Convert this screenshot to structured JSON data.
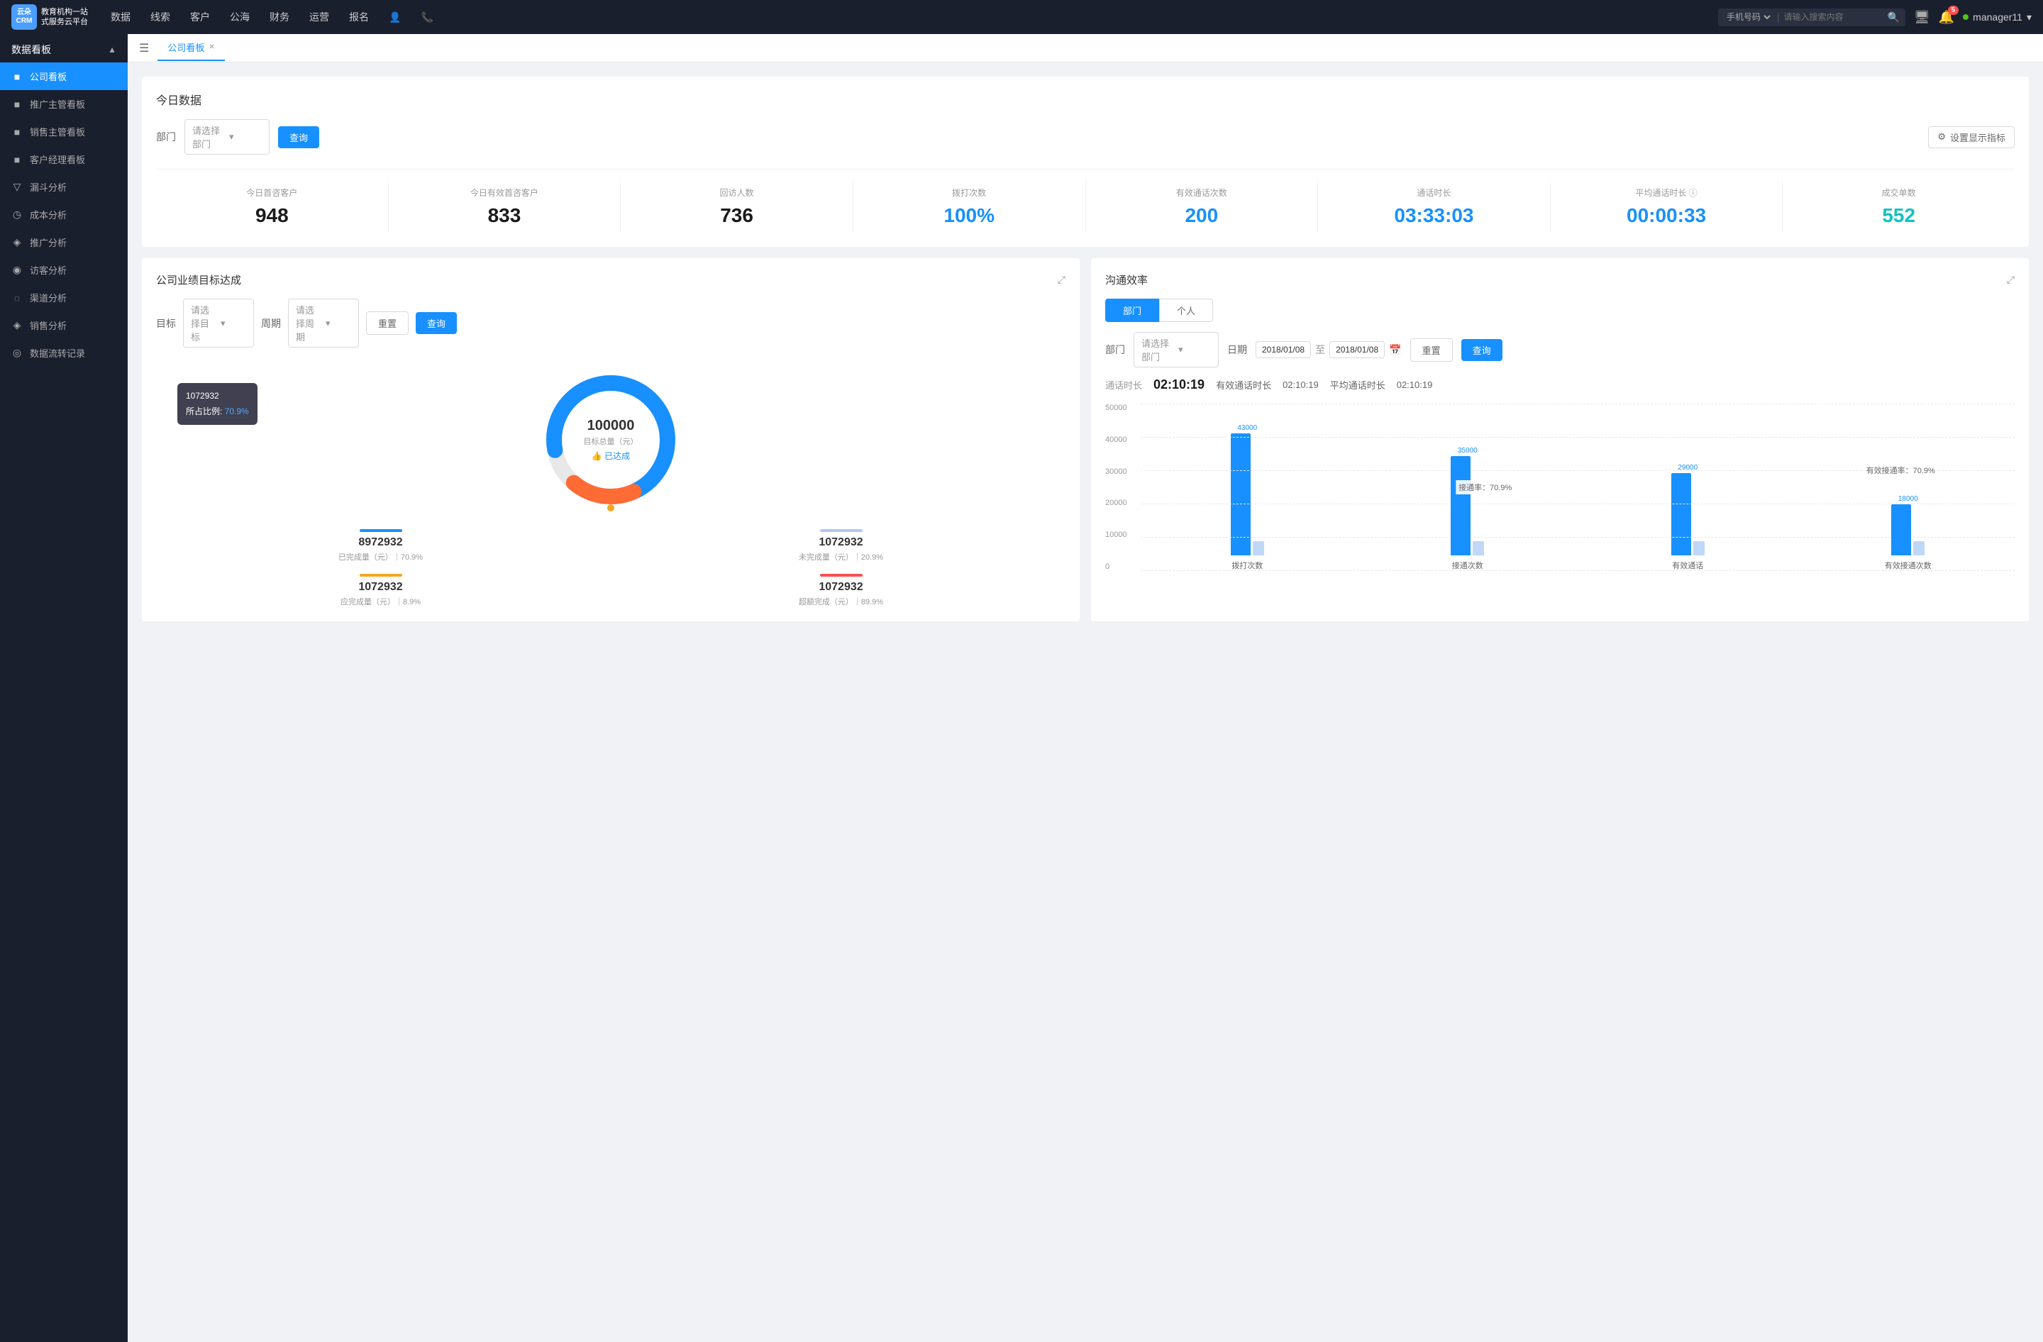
{
  "app": {
    "logo_line1": "云朵CRM",
    "logo_line2": "教育机构一站",
    "logo_line3": "式服务云平台"
  },
  "topnav": {
    "items": [
      "数据",
      "线索",
      "客户",
      "公海",
      "财务",
      "运营",
      "报名"
    ],
    "search_placeholder": "请输入搜索内容",
    "search_select": "手机号码",
    "username": "manager11",
    "notification_count": "5"
  },
  "sidebar": {
    "group_label": "数据看板",
    "items": [
      {
        "label": "公司看板",
        "active": true,
        "icon": "■"
      },
      {
        "label": "推广主管看板",
        "active": false,
        "icon": "■"
      },
      {
        "label": "销售主管看板",
        "active": false,
        "icon": "■"
      },
      {
        "label": "客户经理看板",
        "active": false,
        "icon": "■"
      },
      {
        "label": "漏斗分析",
        "active": false,
        "icon": "▽"
      },
      {
        "label": "成本分析",
        "active": false,
        "icon": "◷"
      },
      {
        "label": "推广分析",
        "active": false,
        "icon": "◈"
      },
      {
        "label": "访客分析",
        "active": false,
        "icon": "◉"
      },
      {
        "label": "渠道分析",
        "active": false,
        "icon": "◌"
      },
      {
        "label": "销售分析",
        "active": false,
        "icon": "◈"
      },
      {
        "label": "数据流转记录",
        "active": false,
        "icon": "◎"
      }
    ]
  },
  "tab": {
    "label": "公司看板"
  },
  "today_section": {
    "title": "今日数据",
    "filter_label": "部门",
    "select_placeholder": "请选择部门",
    "query_btn": "查询",
    "settings_btn": "设置显示指标",
    "stats": [
      {
        "label": "今日首咨客户",
        "value": "948",
        "color": "normal"
      },
      {
        "label": "今日有效首咨客户",
        "value": "833",
        "color": "normal"
      },
      {
        "label": "回访人数",
        "value": "736",
        "color": "normal"
      },
      {
        "label": "拨打次数",
        "value": "100%",
        "color": "blue"
      },
      {
        "label": "有效通话次数",
        "value": "200",
        "color": "blue"
      },
      {
        "label": "通话时长",
        "value": "03:33:03",
        "color": "blue"
      },
      {
        "label": "平均通话时长",
        "value": "00:00:33",
        "color": "blue"
      },
      {
        "label": "成交单数",
        "value": "552",
        "color": "cyan"
      }
    ]
  },
  "goal_section": {
    "title": "公司业绩目标达成",
    "goal_label": "目标",
    "goal_placeholder": "请选择目标",
    "period_label": "周期",
    "period_placeholder": "请选择周期",
    "reset_btn": "重置",
    "query_btn": "查询",
    "donut": {
      "total": "100000",
      "total_label": "目标总量（元）",
      "badge": "👍 已达成",
      "tooltip_id": "1072932",
      "tooltip_pct": "70.9%",
      "completed_value": "8972932",
      "completed_label": "已完成量（元）",
      "completed_pct": "70.9%",
      "uncompleted_value": "1072932",
      "uncompleted_label": "未完成量（元）",
      "uncompleted_pct": "20.9%",
      "should_complete_value": "1072932",
      "should_complete_label": "应完成量（元）",
      "should_complete_pct": "8.9%",
      "over_complete_value": "1072932",
      "over_complete_label": "超额完成（元）",
      "over_complete_pct": "89.9%"
    }
  },
  "comm_section": {
    "title": "沟通效率",
    "tab_dept": "部门",
    "tab_person": "个人",
    "dept_label": "部门",
    "dept_placeholder": "请选择部门",
    "date_label": "日期",
    "date_from": "2018/01/08",
    "date_to": "2018/01/08",
    "reset_btn": "重置",
    "query_btn": "查询",
    "call_duration_label": "通话时长",
    "call_duration_value": "02:10:19",
    "effective_label": "有效通话时长",
    "effective_value": "02:10:19",
    "avg_label": "平均通话时长",
    "avg_value": "02:10:19",
    "chart": {
      "y_ticks": [
        "50000",
        "40000",
        "30000",
        "20000",
        "10000",
        "0"
      ],
      "groups": [
        {
          "label": "拨打次数",
          "bars": [
            {
              "value": 43000,
              "label": "43000",
              "color": "#1890ff",
              "height": 172
            },
            {
              "value": 0,
              "label": "",
              "color": "#b0c8f0",
              "height": 20
            }
          ],
          "rate": ""
        },
        {
          "label": "接通次数",
          "bars": [
            {
              "value": 35000,
              "label": "35000",
              "color": "#1890ff",
              "height": 140
            },
            {
              "value": 0,
              "label": "",
              "color": "#b0c8f0",
              "height": 20
            }
          ],
          "rate": "接通率：70.9%"
        },
        {
          "label": "有效通话",
          "bars": [
            {
              "value": 29000,
              "label": "29000",
              "color": "#1890ff",
              "height": 116
            },
            {
              "value": 0,
              "label": "",
              "color": "#b0c8f0",
              "height": 20
            }
          ],
          "rate": ""
        },
        {
          "label": "有效接通次数",
          "bars": [
            {
              "value": 18000,
              "label": "18000",
              "color": "#1890ff",
              "height": 72
            },
            {
              "value": 0,
              "label": "",
              "color": "#b0c8f0",
              "height": 20
            }
          ],
          "rate": "有效接通率：70.9%"
        }
      ]
    }
  }
}
